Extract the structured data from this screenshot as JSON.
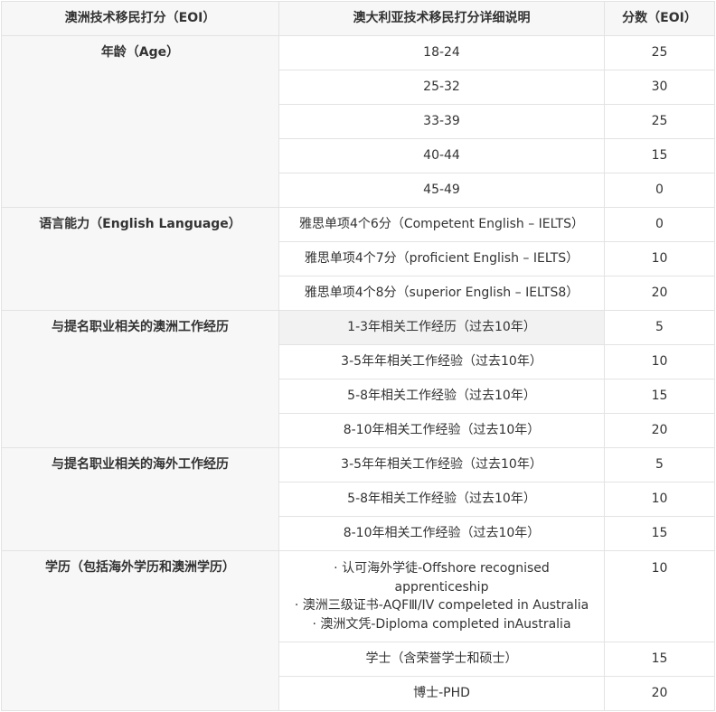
{
  "headers": [
    "澳洲技术移民打分（EOI）",
    "澳大利亚技术移民打分详细说明",
    "分数（EOI）"
  ],
  "sections": [
    {
      "category": "年龄（Age）",
      "rows": [
        {
          "detail": "18-24",
          "points": "25"
        },
        {
          "detail": "25-32",
          "points": "30"
        },
        {
          "detail": "33-39",
          "points": "25"
        },
        {
          "detail": "40-44",
          "points": "15"
        },
        {
          "detail": "45-49",
          "points": "0"
        }
      ]
    },
    {
      "category": "语言能力（English Language）",
      "rows": [
        {
          "detail": "雅思单项4个6分（Competent English – IELTS）",
          "points": "0"
        },
        {
          "detail": "雅思单项4个7分（proficient English – IELTS）",
          "points": "10"
        },
        {
          "detail": "雅思单项4个8分（superior English – IELTS8）",
          "points": "20"
        }
      ]
    },
    {
      "category": "与提名职业相关的澳洲工作经历",
      "rows": [
        {
          "detail": "1-3年相关工作经历（过去10年）",
          "points": "5"
        },
        {
          "detail": "3-5年年相关工作经验（过去10年）",
          "points": "10"
        },
        {
          "detail": "5-8年相关工作经验（过去10年）",
          "points": "15"
        },
        {
          "detail": "8-10年相关工作经验（过去10年）",
          "points": "20"
        }
      ]
    },
    {
      "category": "与提名职业相关的海外工作经历",
      "rows": [
        {
          "detail": "3-5年年相关工作经验（过去10年）",
          "points": "5"
        },
        {
          "detail": "5-8年相关工作经验（过去10年）",
          "points": "10"
        },
        {
          "detail": "8-10年相关工作经验（过去10年）",
          "points": "15"
        }
      ]
    },
    {
      "category": "学历（包括海外学历和澳洲学历）",
      "rows": [
        {
          "detail_lines": [
            "· 认可海外学徒-Offshore recognised",
            "apprenticeship",
            "· 澳洲三级证书-AQFⅢ/IV compeleted in Australia",
            "· 澳洲文凭-Diploma completed inAustralia"
          ],
          "points": "10"
        },
        {
          "detail": "学士（含荣誉学士和硕士）",
          "points": "15"
        },
        {
          "detail": "博士-PHD",
          "points": "20"
        }
      ]
    }
  ]
}
